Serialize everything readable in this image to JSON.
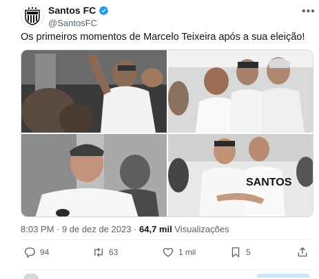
{
  "tweet": {
    "author_name": "Santos FC",
    "author_handle": "@SantosFC",
    "text": "Os primeiros momentos de Marcelo Teixeira após a sua eleição!",
    "timestamp": "8:03 PM · 9 de dez de 2023 · ",
    "views_count": "64,7 mil",
    "views_label": " Visualizações"
  },
  "actions": {
    "replies": "94",
    "retweets": "63",
    "likes": "1 mil",
    "bookmarks": "5"
  },
  "photos": {
    "shirt_text": "SANTOS"
  },
  "colors": {
    "verified": "#1d9bf0",
    "text_secondary": "#536471",
    "text_primary": "#0f1419"
  },
  "icons": [
    "santos-logo-icon",
    "verified-badge-icon",
    "more-icon",
    "reply-icon",
    "retweet-icon",
    "like-icon",
    "bookmark-icon",
    "share-icon"
  ]
}
